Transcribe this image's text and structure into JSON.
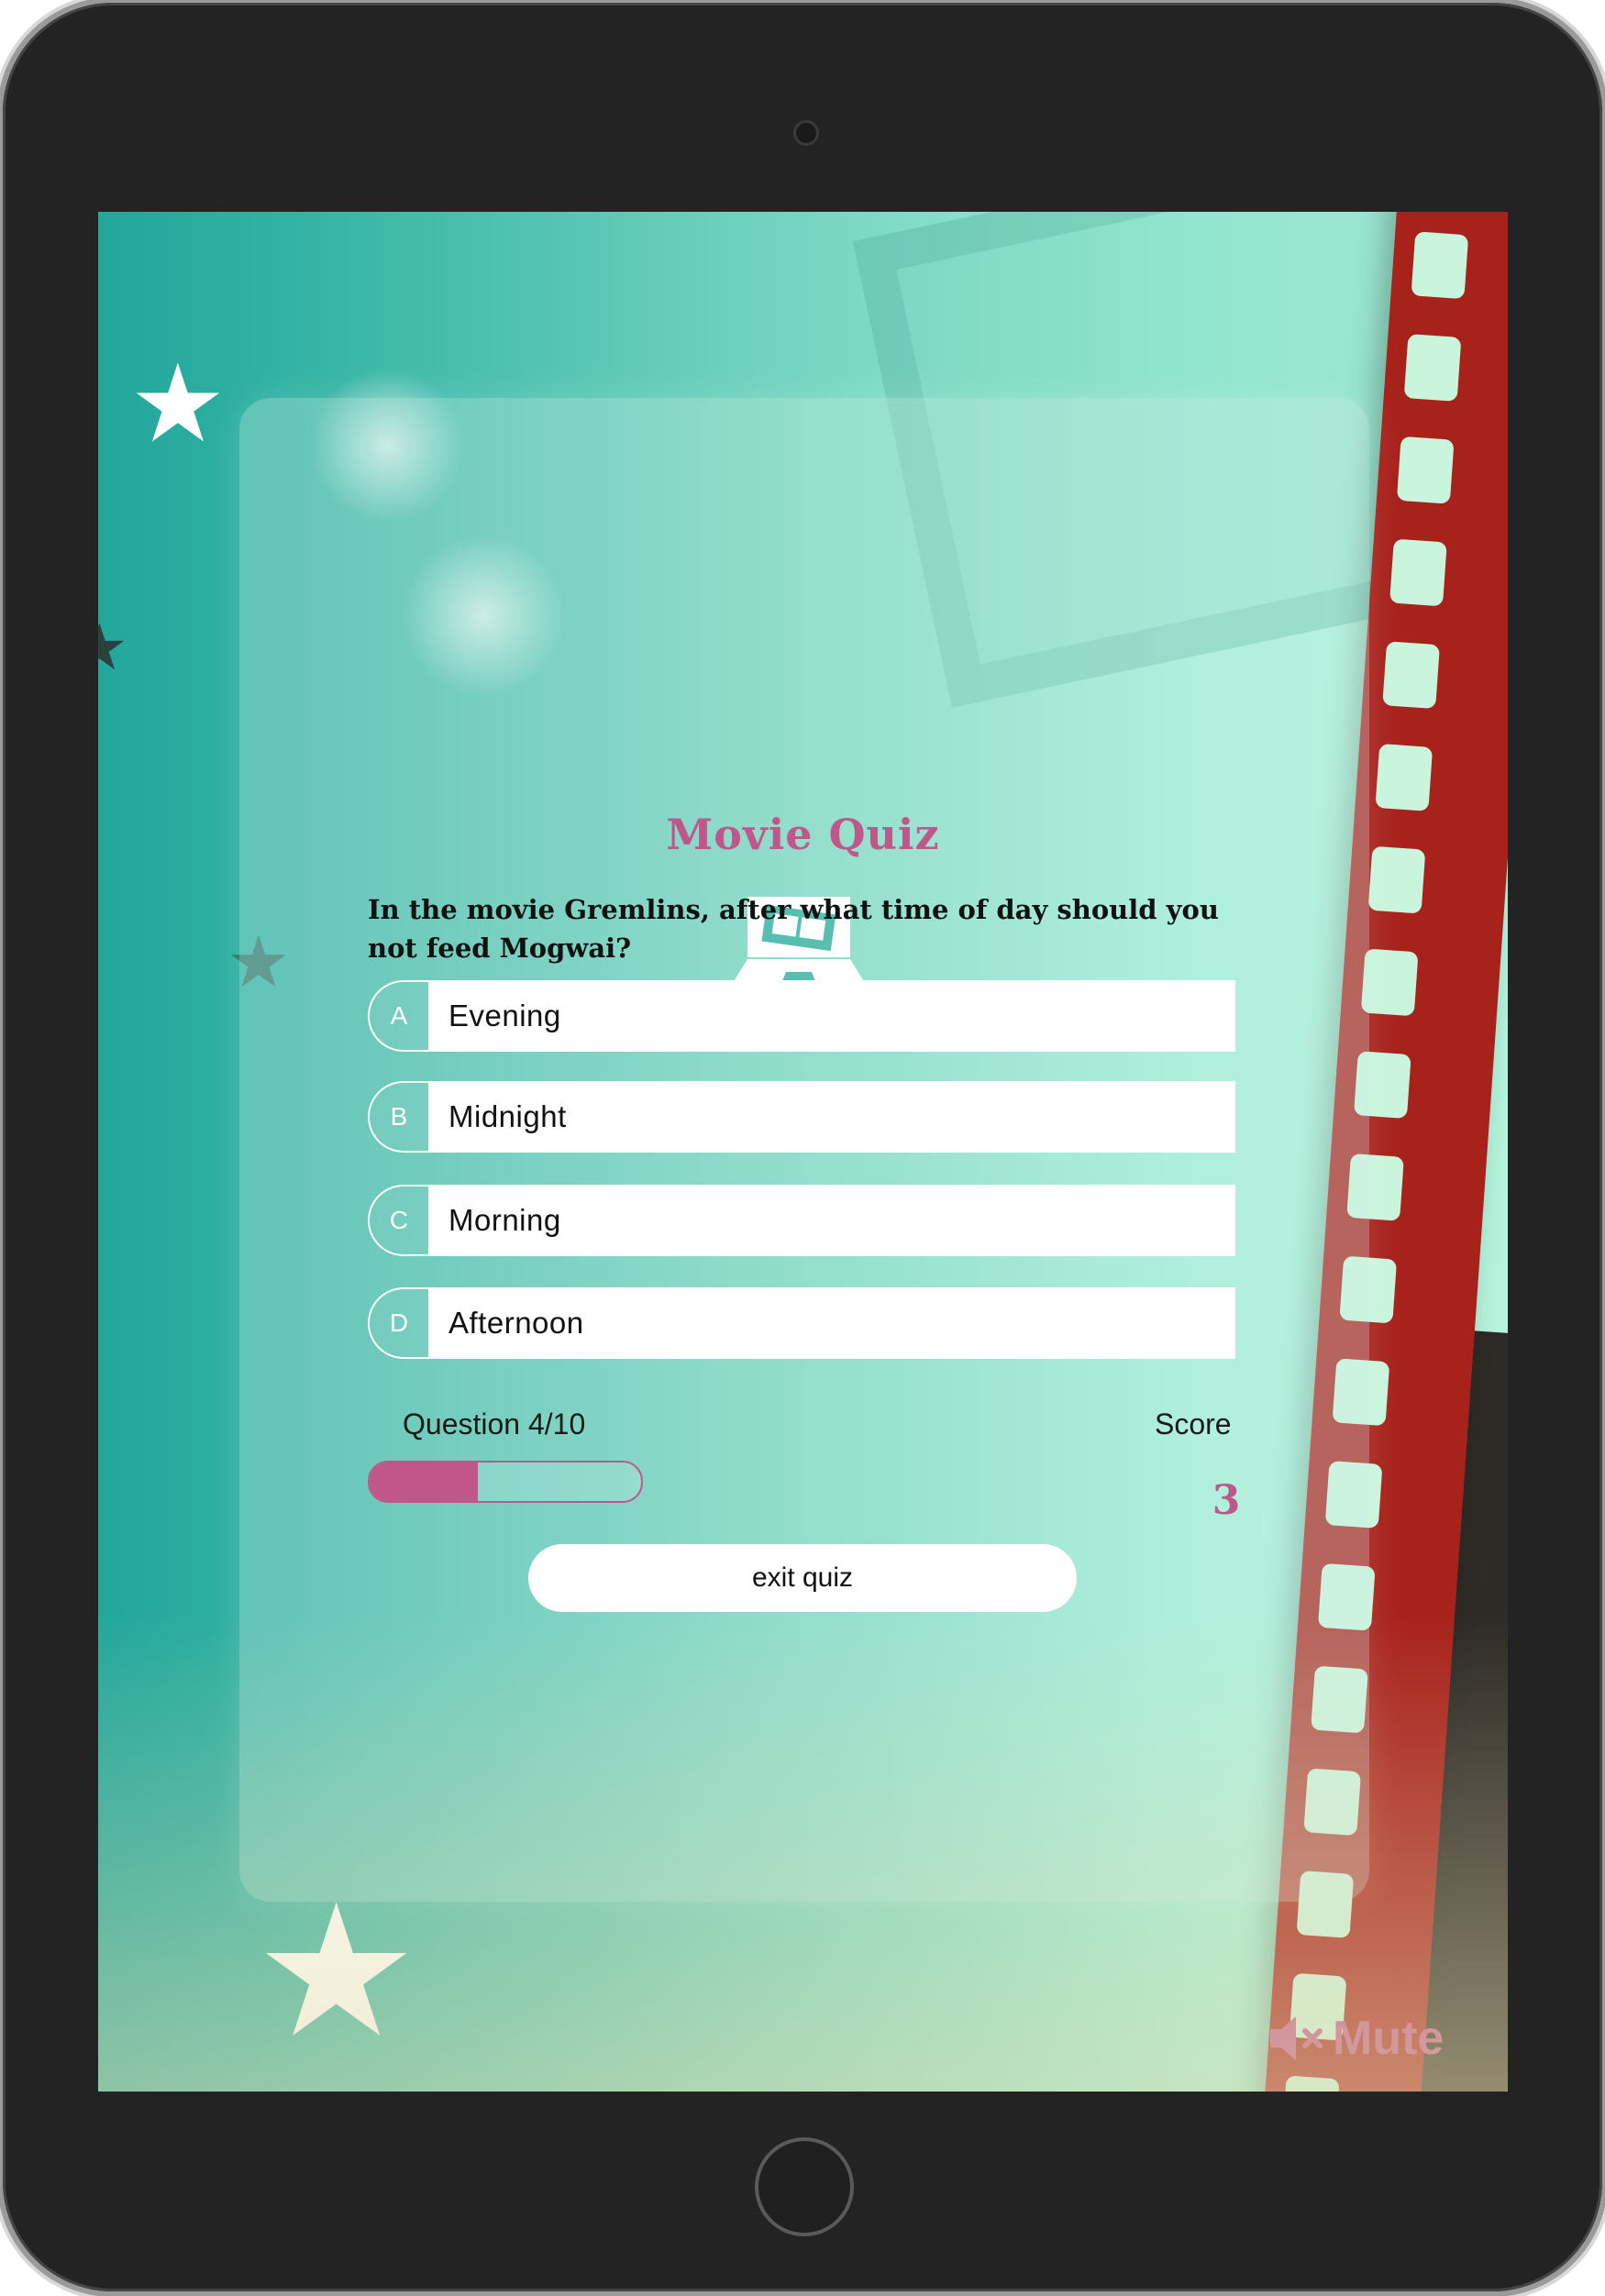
{
  "app": {
    "title": "Movie Quiz"
  },
  "quiz": {
    "question": "In the movie Gremlins, after what time of day should you not feed Mogwai?",
    "answers": [
      {
        "letter": "A",
        "text": "Evening"
      },
      {
        "letter": "B",
        "text": "Midnight"
      },
      {
        "letter": "C",
        "text": "Morning"
      },
      {
        "letter": "D",
        "text": "Afternoon"
      }
    ],
    "progress_text": "Question 4/10",
    "progress_fraction": 0.4,
    "score_label": "Score",
    "score_value": "3",
    "exit_label": "exit quiz"
  },
  "sound": {
    "mute_label": "Mute",
    "icon": "speaker-muted-icon"
  },
  "colors": {
    "accent": "#c0568a",
    "teal": "#2fb1a2",
    "mint": "#9ff0d8"
  }
}
